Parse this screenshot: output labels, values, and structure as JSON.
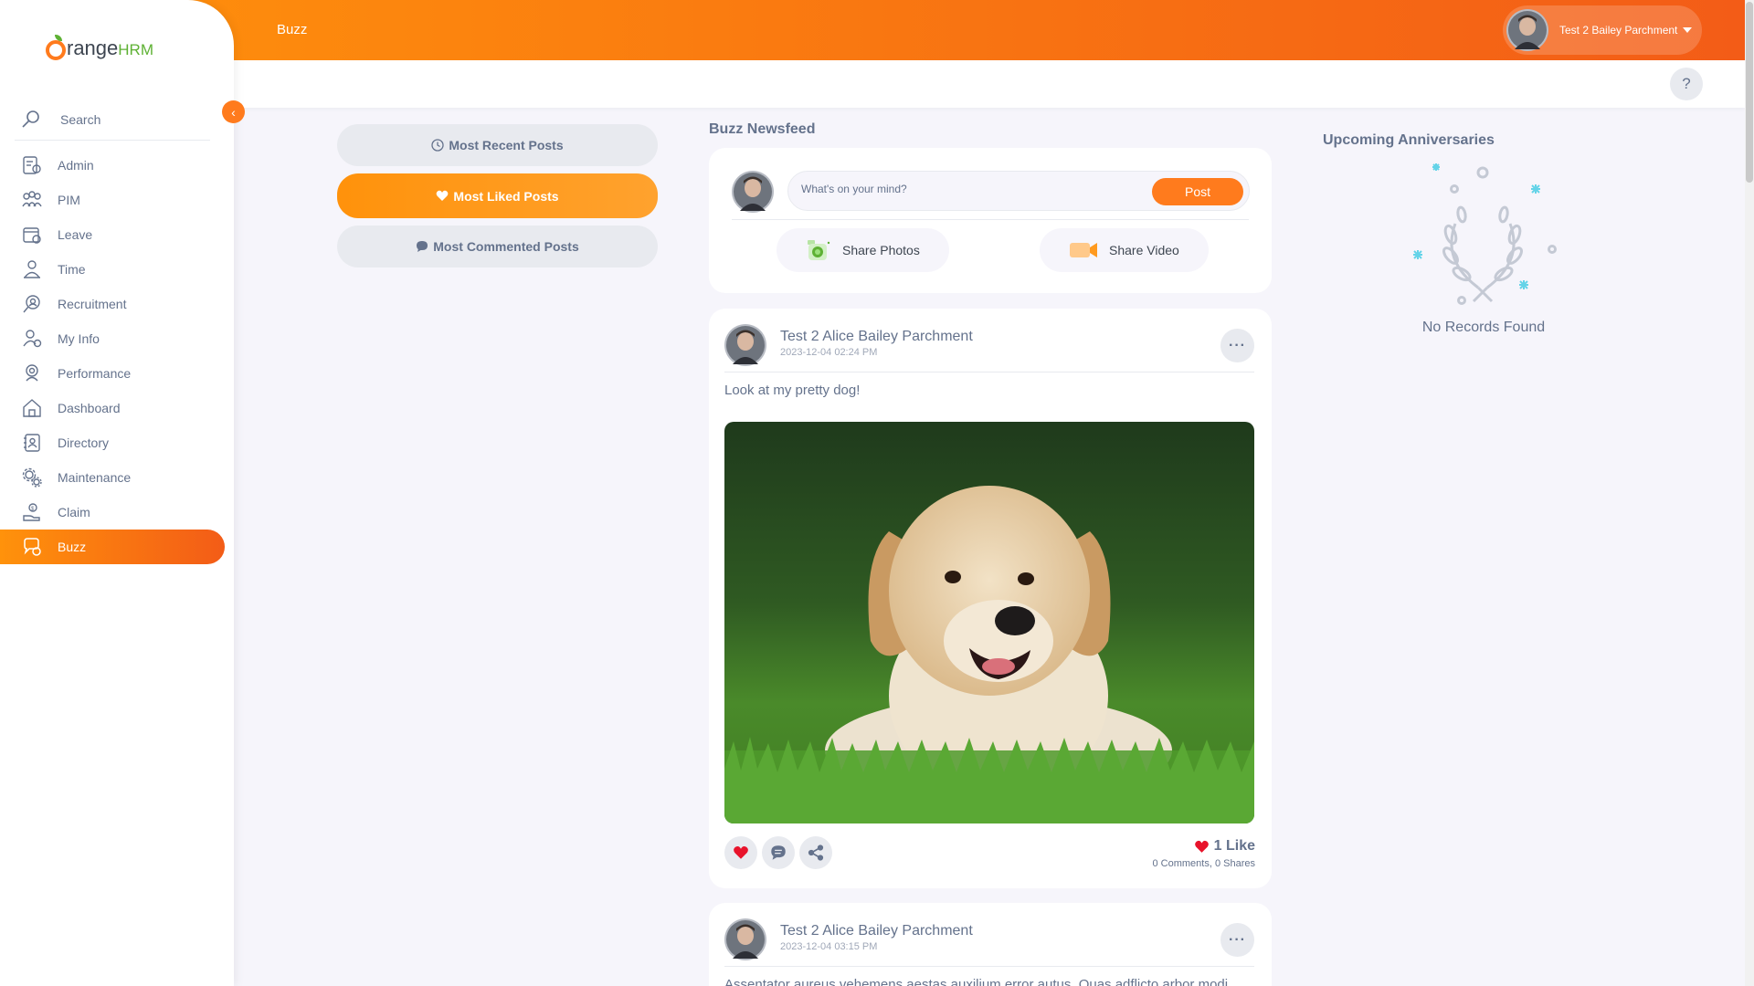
{
  "app": {
    "brand": "OrangeHRM",
    "brand_prefix": "range",
    "brand_suffix": "HRM",
    "accent": "#ff7b1d"
  },
  "topbar": {
    "title": "Buzz",
    "user_name": "Test 2 Bailey Parchment",
    "help": "?"
  },
  "sidebar": {
    "search_placeholder": "Search",
    "collapse_icon": "‹",
    "items": [
      {
        "label": "Admin",
        "icon": "admin-icon"
      },
      {
        "label": "PIM",
        "icon": "pim-icon"
      },
      {
        "label": "Leave",
        "icon": "leave-icon"
      },
      {
        "label": "Time",
        "icon": "time-icon"
      },
      {
        "label": "Recruitment",
        "icon": "recruitment-icon"
      },
      {
        "label": "My Info",
        "icon": "my-info-icon"
      },
      {
        "label": "Performance",
        "icon": "performance-icon"
      },
      {
        "label": "Dashboard",
        "icon": "dashboard-icon"
      },
      {
        "label": "Directory",
        "icon": "directory-icon"
      },
      {
        "label": "Maintenance",
        "icon": "maintenance-icon"
      },
      {
        "label": "Claim",
        "icon": "claim-icon"
      },
      {
        "label": "Buzz",
        "icon": "buzz-icon",
        "active": true
      }
    ]
  },
  "filters": {
    "most_recent": "Most Recent Posts",
    "most_liked": "Most Liked Posts",
    "most_commented": "Most Commented Posts"
  },
  "feed": {
    "heading": "Buzz Newsfeed",
    "composer_placeholder": "What's on your mind?",
    "post_button": "Post",
    "share_photos": "Share Photos",
    "share_video": "Share Video",
    "posts": [
      {
        "author": "Test 2 Alice Bailey Parchment",
        "timestamp": "2023-12-04 02:24 PM",
        "text": "Look at my pretty dog!",
        "likes": "1 Like",
        "comments": "0 Comments",
        "shares": "0 Shares",
        "more": "···"
      },
      {
        "author": "Test 2 Alice Bailey Parchment",
        "timestamp": "2023-12-04 03:15 PM",
        "text": "Assentator aureus vehemens aestas auxilium error autus. Quas adflicto arbor modi",
        "more": "···"
      }
    ]
  },
  "anniversaries": {
    "heading": "Upcoming Anniversaries",
    "empty": "No Records Found"
  }
}
